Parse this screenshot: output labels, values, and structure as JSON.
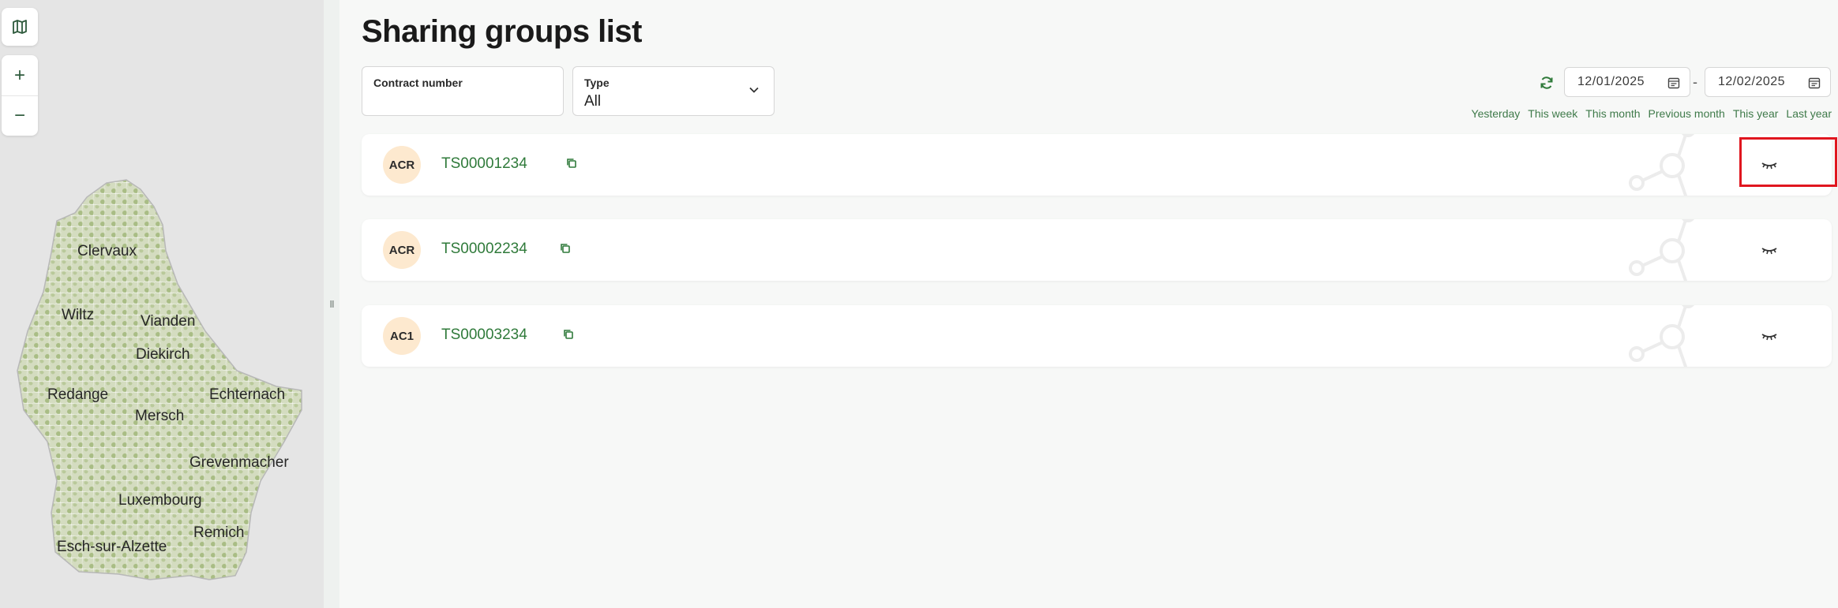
{
  "map": {
    "icon": "map-icon",
    "zoom_in_label": "+",
    "zoom_out_label": "−",
    "cities": [
      "Clervaux",
      "Wiltz",
      "Vianden",
      "Diekirch",
      "Redange",
      "Echternach",
      "Mersch",
      "Grevenmacher",
      "Luxembourg",
      "Remich",
      "Esch-sur-Alzette"
    ],
    "colors": {
      "land": "#d4dcc0",
      "forest": "#9fb679",
      "background": "#e5e5e5"
    }
  },
  "splitter": {
    "grip": "II"
  },
  "page": {
    "title": "Sharing groups list"
  },
  "filters": {
    "contract_number": {
      "label": "Contract number",
      "value": ""
    },
    "type": {
      "label": "Type",
      "value": "All"
    }
  },
  "dates": {
    "from": "12/01/2025",
    "separator": "-",
    "to": "12/02/2025"
  },
  "shortcuts": [
    "Yesterday",
    "This week",
    "This month",
    "Previous month",
    "This year",
    "Last year"
  ],
  "groups": [
    {
      "badge": "ACR",
      "contract": "TS00001234"
    },
    {
      "badge": "ACR",
      "contract": "TS00002234"
    },
    {
      "badge": "AC1",
      "contract": "TS00003234"
    }
  ],
  "colors": {
    "accent": "#2f7a3a",
    "badge_bg": "#fde9cf",
    "highlight": "#e0161f"
  }
}
